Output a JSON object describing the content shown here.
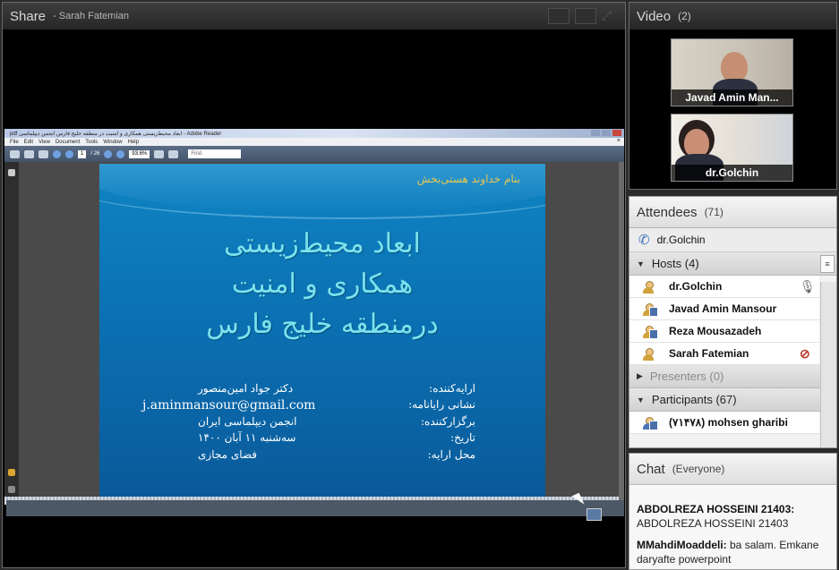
{
  "share": {
    "title": "Share",
    "presenter": "- Sarah Fatemian"
  },
  "reader": {
    "window_title": "pdf ابعاد محیط‌زیستی همکاری و امنیت در منطقه خلیج فارس انجمن دیپلماسی - Adobe Reader",
    "menu": [
      "File",
      "Edit",
      "View",
      "Document",
      "Tools",
      "Window",
      "Help"
    ],
    "page_current": "1",
    "page_total": "/ 26",
    "zoom": "93.6%",
    "find_placeholder": "Find"
  },
  "slide": {
    "top_line": "بنام خداوند هستی‌بخش",
    "title_lines": [
      "ابعاد محیط‌زیستی",
      "همکاری و امنیت",
      "درمنطقه خلیج فارس"
    ],
    "rows": [
      {
        "label": "ارایه‌کننده:",
        "value": "دکتر جواد امین‌منصور"
      },
      {
        "label": "نشانی رایانامه:",
        "value": "j.aminmansour@gmail.com"
      },
      {
        "label": "برگزارکننده:",
        "value": "انجمن دیپلماسی ایران"
      },
      {
        "label": "تاریخ:",
        "value": "سه‌شنبه ۱۱ آبان ۱۴۰۰"
      },
      {
        "label": "محل ارایه:",
        "value": "فضای مجازی"
      }
    ]
  },
  "video": {
    "title": "Video",
    "count": "(2)",
    "tiles": [
      {
        "name": "Javad Amin Man..."
      },
      {
        "name": "dr.Golchin"
      }
    ]
  },
  "attendees": {
    "title": "Attendees",
    "count": "(71)",
    "current_user": "dr.Golchin",
    "hosts_label": "Hosts (4)",
    "hosts": [
      "dr.Golchin",
      "Javad Amin Mansour",
      "Reza Mousazadeh",
      "Sarah Fatemian"
    ],
    "presenters_label": "Presenters (0)",
    "participants_label": "Participants (67)",
    "participants": [
      "(۷۱۴۷۸) mohsen gharibi"
    ]
  },
  "chat": {
    "title": "Chat",
    "scope": "(Everyone)",
    "messages": [
      {
        "sender": "ABDOLREZA HOSSEINI 21403:",
        "text": "ABDOLREZA HOSSEINI  21403"
      },
      {
        "sender": "MMahdiMoaddeli:",
        "text": " ba salam. Emkane daryafte powerpoint"
      }
    ]
  },
  "colors": {
    "slide_bg": "#0b70b2",
    "slide_title": "#7be3ec",
    "slide_top_line": "#e8c850",
    "pod_header_dark": "#2f2f2f",
    "mic_active": "#c0392b"
  }
}
